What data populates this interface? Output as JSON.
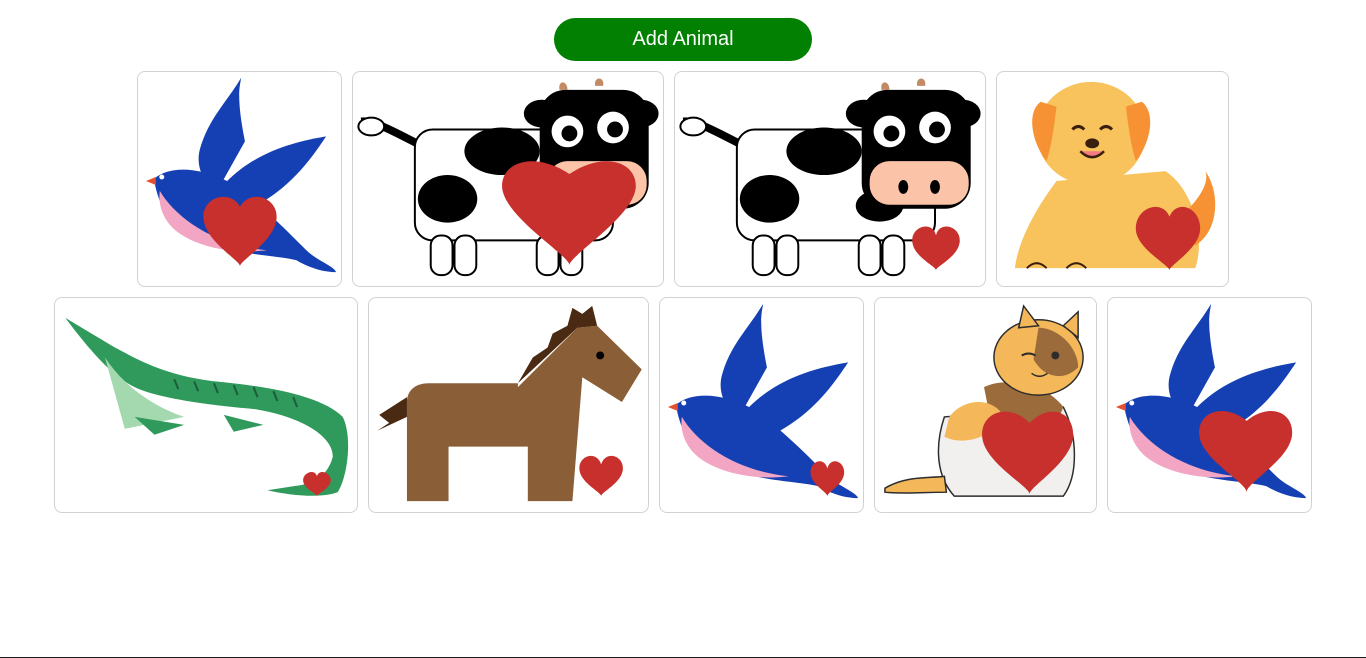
{
  "toolbar": {
    "add_label": "Add Animal",
    "add_color": "#018001"
  },
  "animals": [
    {
      "kind": "bird-icon"
    },
    {
      "kind": "cow-icon"
    },
    {
      "kind": "cow-icon"
    },
    {
      "kind": "dog-icon"
    },
    {
      "kind": "crocodile-icon"
    },
    {
      "kind": "horse-icon"
    },
    {
      "kind": "bird-icon"
    },
    {
      "kind": "cat-icon"
    },
    {
      "kind": "bird-icon"
    }
  ],
  "colors": {
    "heart": "#c7302c",
    "bird": "#1540b4",
    "cow": "#000000",
    "dog": "#f8c25c",
    "croc": "#2f9a5b",
    "horse": "#8a5f38",
    "cat": "#f4b85a"
  }
}
